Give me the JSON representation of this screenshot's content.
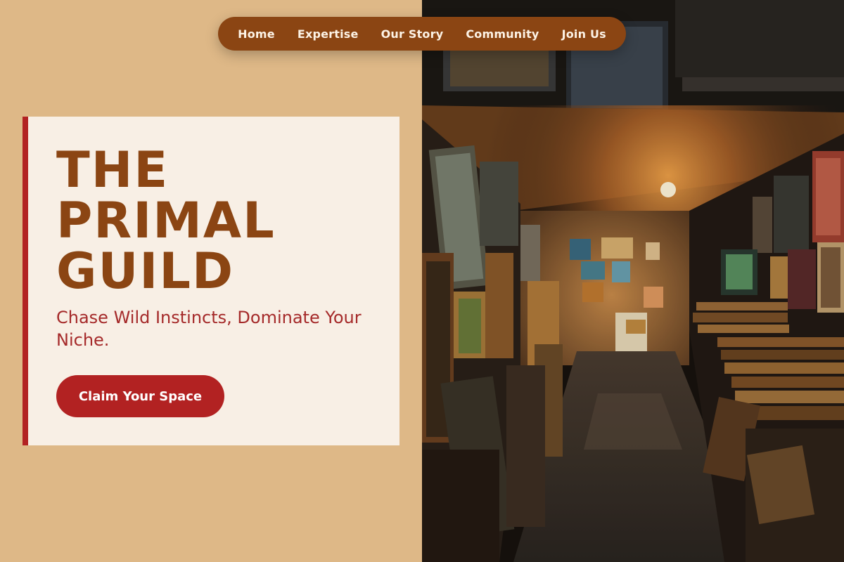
{
  "nav": {
    "items": [
      {
        "label": "Home"
      },
      {
        "label": "Expertise"
      },
      {
        "label": "Our Story"
      },
      {
        "label": "Community"
      },
      {
        "label": "Join Us"
      }
    ]
  },
  "hero": {
    "title": "THE PRIMAL GUILD",
    "tagline": "Chase Wild Instincts, Dominate Your Niche.",
    "cta_label": "Claim Your Space"
  },
  "colors": {
    "page_background": "#deb887",
    "nav_background": "#8b4513",
    "card_background": "#f8efe5",
    "accent": "#b22222",
    "title_color": "#8b4513",
    "tagline_color": "#a52a2a"
  }
}
